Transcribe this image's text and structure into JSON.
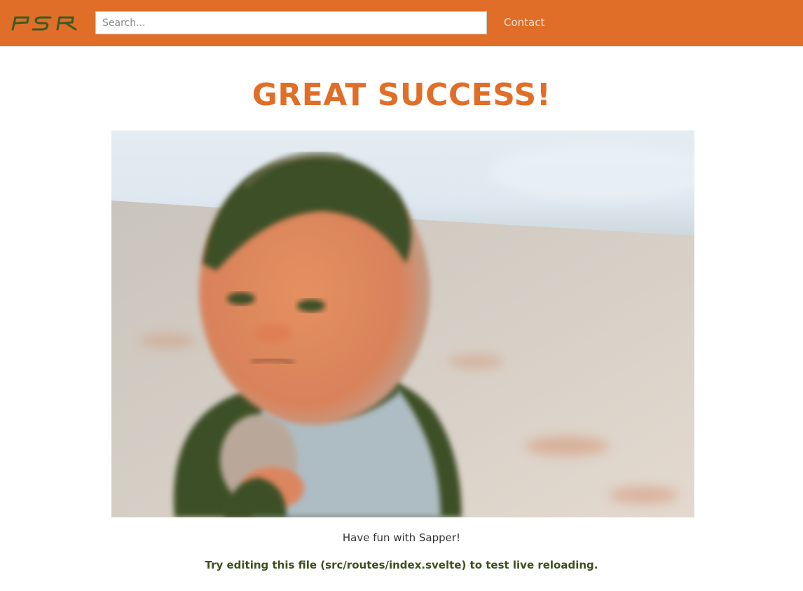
{
  "header": {
    "logo_text": "PSR",
    "search_placeholder": "Search...",
    "nav_contact": "Contact"
  },
  "main": {
    "title": "GREAT SUCCESS!",
    "hero_image": {
      "alt": "Success Kid"
    },
    "caption": "Have fun with Sapper!",
    "hint": "Try editing this file (src/routes/index.svelte) to test live reloading."
  },
  "colors": {
    "brand": "#e06e28",
    "logo": "#3d5a22",
    "hint_text": "#3d4f1f"
  }
}
